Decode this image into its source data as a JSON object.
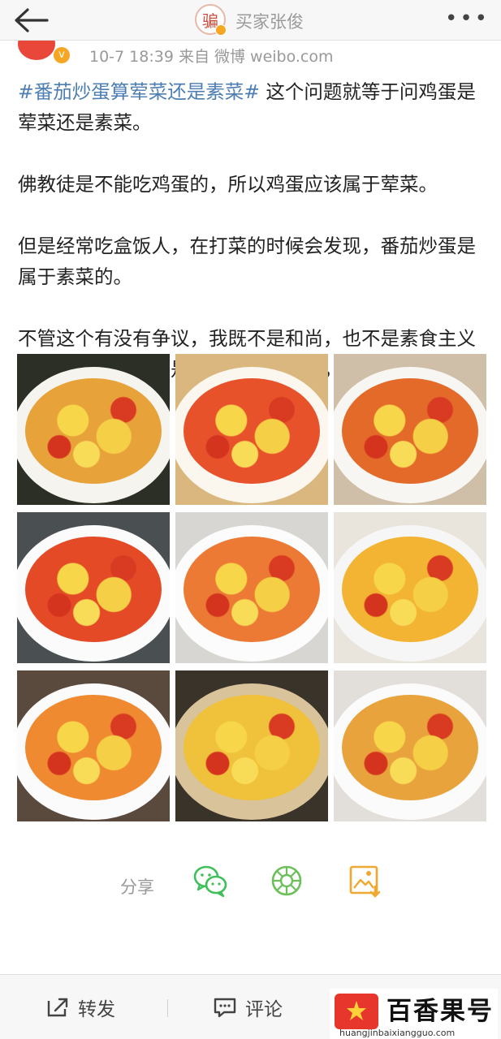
{
  "header": {
    "avatar_char": "骗",
    "account_name": "买家张俊",
    "more_label": "•••"
  },
  "post_meta": {
    "avatar_char": "",
    "time_source": "10-7 18:39  来自 微博 weibo.com"
  },
  "post": {
    "hashtag": "#番茄炒蛋算荤菜还是素菜#",
    "p1_rest": " 这个问题就等于问鸡蛋是荤菜还是素菜。",
    "p2": "佛教徒是不能吃鸡蛋的，所以鸡蛋应该属于荤菜。",
    "p3": "但是经常吃盒饭人，在打菜的时候会发现，番茄炒蛋是属于素菜的。",
    "p4": "不管这个有没有争议，我既不是和尚，也不是素食主义者，番茄炒蛋是荤是素都不会困扰我，只要好吃就行。"
  },
  "images": [
    {
      "name": "photo-1",
      "bg": "#2b2f26",
      "plate": "#f6f4ee",
      "food": "#e8a23a"
    },
    {
      "name": "photo-2",
      "bg": "#d9b77f",
      "plate": "#fbf7ef",
      "food": "#e7522b"
    },
    {
      "name": "photo-3",
      "bg": "#cfbfa8",
      "plate": "#f8f6f2",
      "food": "#e46a2a"
    },
    {
      "name": "photo-4",
      "bg": "#4a4f52",
      "plate": "#fbfbfb",
      "food": "#e44a26"
    },
    {
      "name": "photo-5",
      "bg": "#d8d6d2",
      "plate": "#fcfcfc",
      "food": "#ec7a35"
    },
    {
      "name": "photo-6",
      "bg": "#e9e4dc",
      "plate": "#f6f6f6",
      "food": "#f2b432"
    },
    {
      "name": "photo-7",
      "bg": "#5a4a3e",
      "plate": "#fbfbfb",
      "food": "#ef8a30"
    },
    {
      "name": "photo-8",
      "bg": "#3a332a",
      "plate": "#d9c39a",
      "food": "#f0c13a"
    },
    {
      "name": "photo-9",
      "bg": "#e2dfda",
      "plate": "#fbfbfb",
      "food": "#e9a33c"
    }
  ],
  "actions": {
    "share_label": "分享",
    "share_targets": [
      "wechat-icon",
      "moments-icon",
      "save-image-icon"
    ]
  },
  "bottom": {
    "repost_label": "转发",
    "comment_label": "评论"
  },
  "watermark": {
    "title": "百香果号",
    "url": "huangjinbaixiangguo.com"
  },
  "colors": {
    "link": "#4d7eb3",
    "wechat_green": "#3fbf5a",
    "moments_green": "#6cc05a",
    "save_orange": "#f0a830",
    "brand_red": "#e7372c"
  }
}
